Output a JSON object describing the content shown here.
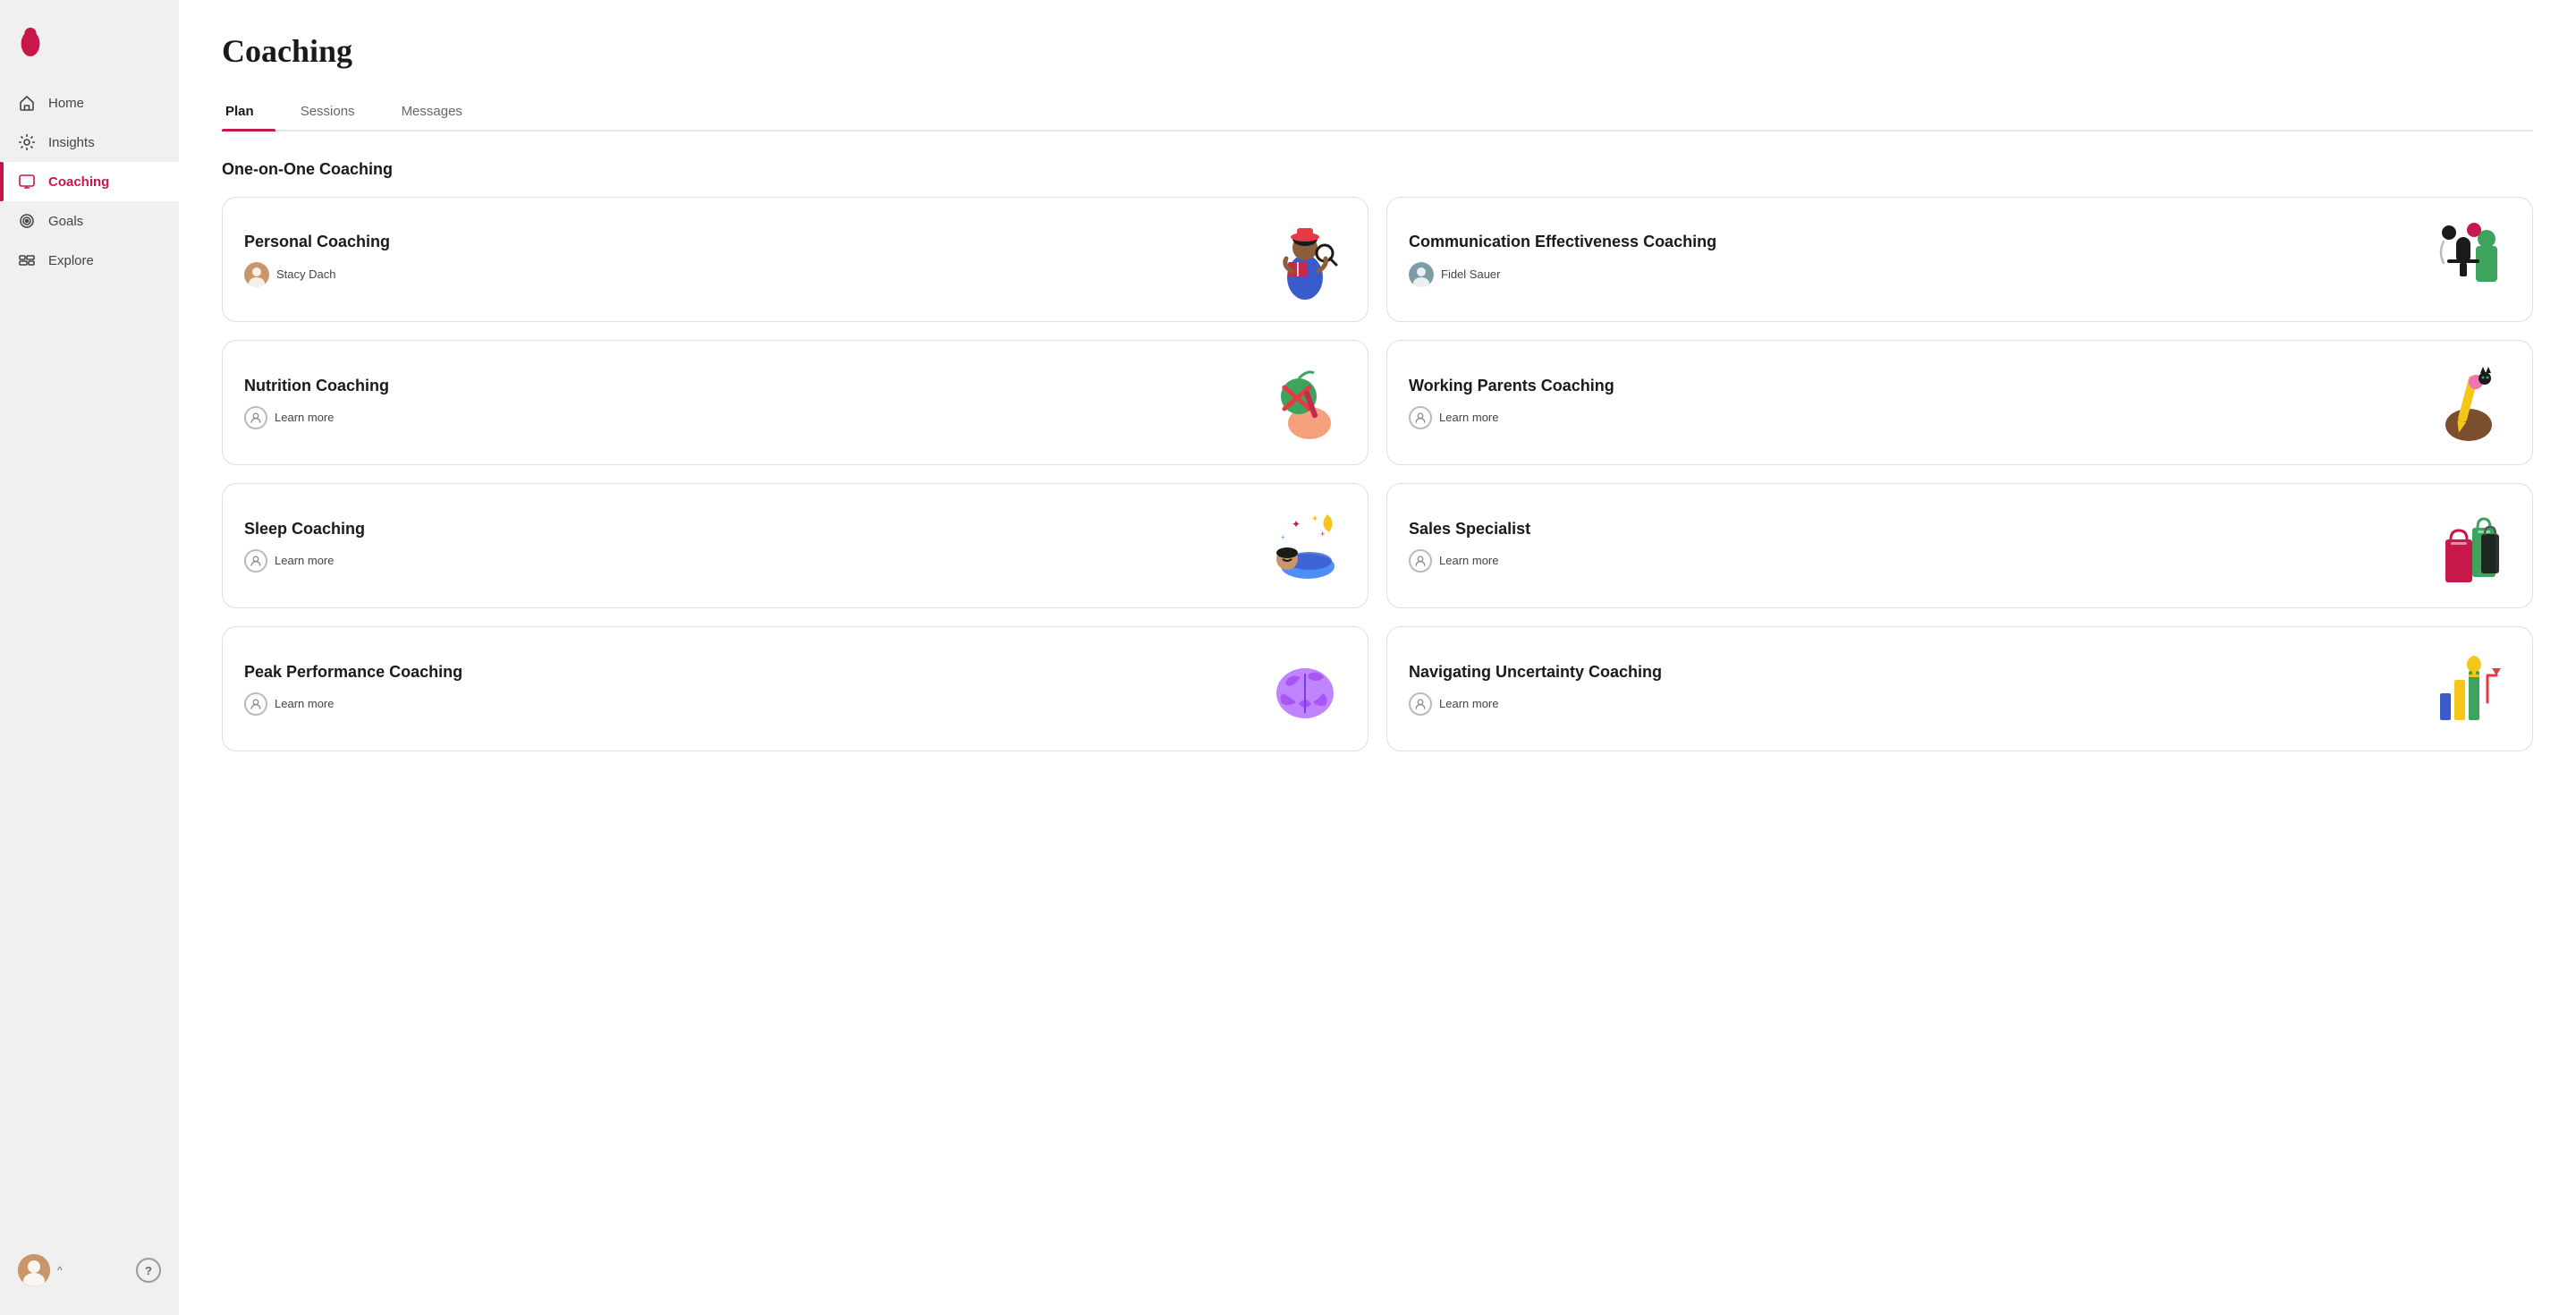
{
  "sidebar": {
    "nav_items": [
      {
        "id": "home",
        "label": "Home",
        "icon": "home-icon",
        "active": false
      },
      {
        "id": "insights",
        "label": "Insights",
        "icon": "insights-icon",
        "active": false
      },
      {
        "id": "coaching",
        "label": "Coaching",
        "icon": "coaching-icon",
        "active": true
      },
      {
        "id": "goals",
        "label": "Goals",
        "icon": "goals-icon",
        "active": false
      },
      {
        "id": "explore",
        "label": "Explore",
        "icon": "explore-icon",
        "active": false
      }
    ],
    "help_label": "?",
    "chevron_label": "^"
  },
  "page": {
    "title": "Coaching",
    "tabs": [
      {
        "id": "plan",
        "label": "Plan",
        "active": true
      },
      {
        "id": "sessions",
        "label": "Sessions",
        "active": false
      },
      {
        "id": "messages",
        "label": "Messages",
        "active": false
      }
    ],
    "section_title": "One-on-One Coaching",
    "cards": [
      {
        "id": "personal-coaching",
        "title": "Personal Coaching",
        "type": "coach",
        "coach_name": "Stacy Dach",
        "illustration": "personal"
      },
      {
        "id": "communication-coaching",
        "title": "Communication Effectiveness Coaching",
        "type": "coach",
        "coach_name": "Fidel Sauer",
        "illustration": "communication"
      },
      {
        "id": "nutrition-coaching",
        "title": "Nutrition Coaching",
        "type": "learn",
        "learn_more": "Learn more",
        "illustration": "nutrition"
      },
      {
        "id": "working-parents-coaching",
        "title": "Working Parents Coaching",
        "type": "learn",
        "learn_more": "Learn more",
        "illustration": "working-parents"
      },
      {
        "id": "sleep-coaching",
        "title": "Sleep Coaching",
        "type": "learn",
        "learn_more": "Learn more",
        "illustration": "sleep"
      },
      {
        "id": "sales-specialist",
        "title": "Sales Specialist",
        "type": "learn",
        "learn_more": "Learn more",
        "illustration": "sales"
      },
      {
        "id": "peak-performance-coaching",
        "title": "Peak Performance Coaching",
        "type": "learn",
        "learn_more": "Learn more",
        "illustration": "peak"
      },
      {
        "id": "navigating-uncertainty-coaching",
        "title": "Navigating Uncertainty Coaching",
        "type": "learn",
        "learn_more": "Learn more",
        "illustration": "uncertainty"
      }
    ]
  },
  "colors": {
    "brand": "#c8184a",
    "active_nav": "#c8184a"
  }
}
